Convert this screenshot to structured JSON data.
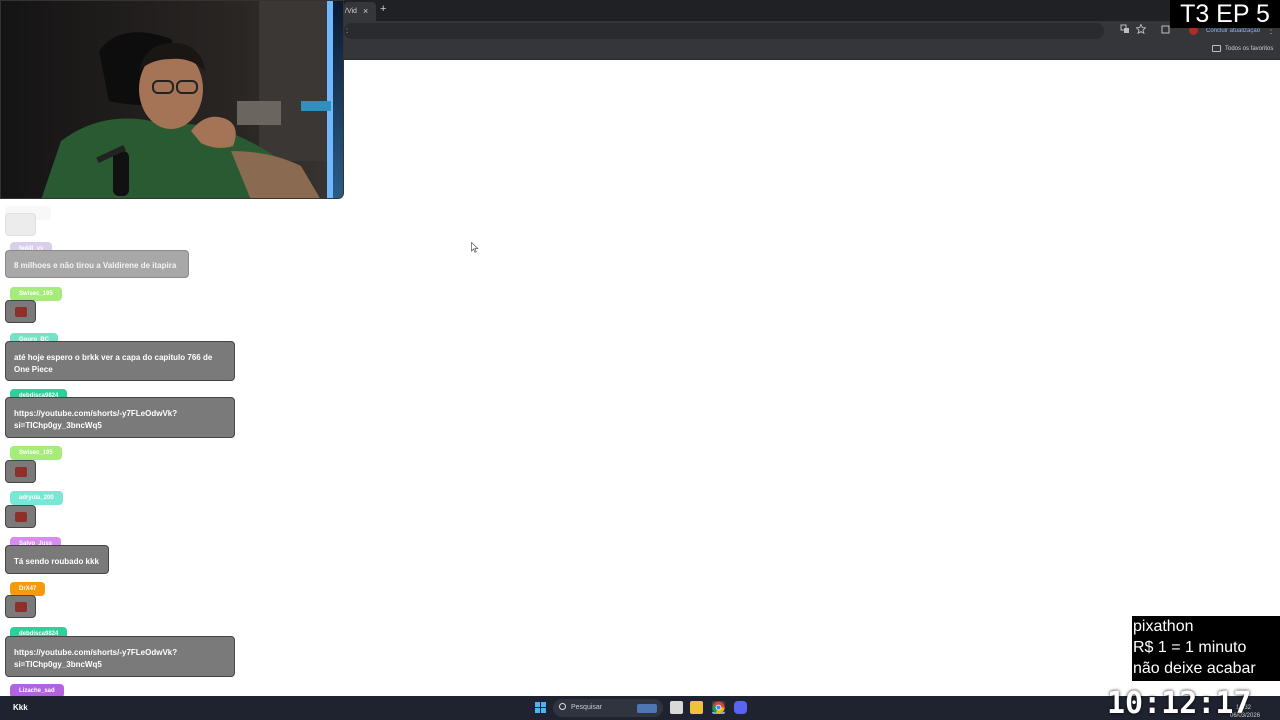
{
  "browser": {
    "tab_title": "/Vid",
    "tab_close": "×",
    "new_tab": "+",
    "address_menu": ":",
    "toolbar_icons": [
      "translate-icon",
      "star-icon",
      "extensions-icon"
    ],
    "update_button_label": "Concluir atualização",
    "menu": "⋮",
    "bookmarks_all_label": "Todos os favoritos"
  },
  "overlay": {
    "episode_label": "T3 EP 5",
    "pixathon_lines": [
      "pixathon",
      "R$ 1 = 1 minuto",
      "não deixe acabar"
    ],
    "clock_time": "10:12:17"
  },
  "chat": {
    "messages": [
      {
        "user": "fed4t_yy",
        "user_color": "#c9bce6",
        "text": "8 milhoes e não tirou a Valdirene de itapira",
        "faded": true
      },
      {
        "user": "Swisec_195",
        "user_color": "#a6ec7a",
        "emote": true
      },
      {
        "user": "Gouro_BC",
        "user_color": "#74e3c5",
        "text": "até hoje espero o brkk ver a capa do capitulo 766 de One Piece"
      },
      {
        "user": "debdisca9824",
        "user_color": "#2ecf98",
        "text": "https://youtube.com/shorts/-y7FLeOdwVk?si=TIChp0gy_3bncWq5"
      },
      {
        "user": "Swisec_195",
        "user_color": "#a6ec7a",
        "emote": true
      },
      {
        "user": "adryola_200",
        "user_color": "#79e7d6",
        "emote": true
      },
      {
        "user": "Salvo_Juss",
        "user_color": "#d88cf0",
        "text": "Tá sendo roubado kkk"
      },
      {
        "user": "DrX47",
        "user_color": "#f59a0a",
        "emote": true
      },
      {
        "user": "debdisca9824",
        "user_color": "#2ecf98",
        "text": "https://youtube.com/shorts/-y7FLeOdwVk?si=TIChp0gy_3bncWq5"
      },
      {
        "user": "Lizache_sad",
        "user_color": "#b163e0"
      }
    ]
  },
  "taskbar": {
    "left_text": "Kkk",
    "search_placeholder": "Pesquisar",
    "apps": [
      "file-explorer-icon",
      "chrome-icon",
      "discord-icon"
    ],
    "tray_time": "10:32",
    "tray_date": "06/03/2026"
  },
  "colors": {
    "chat_bubble": "#7a7a7a",
    "browser_toolbar": "#35363a",
    "taskbar": "#1f2330"
  }
}
